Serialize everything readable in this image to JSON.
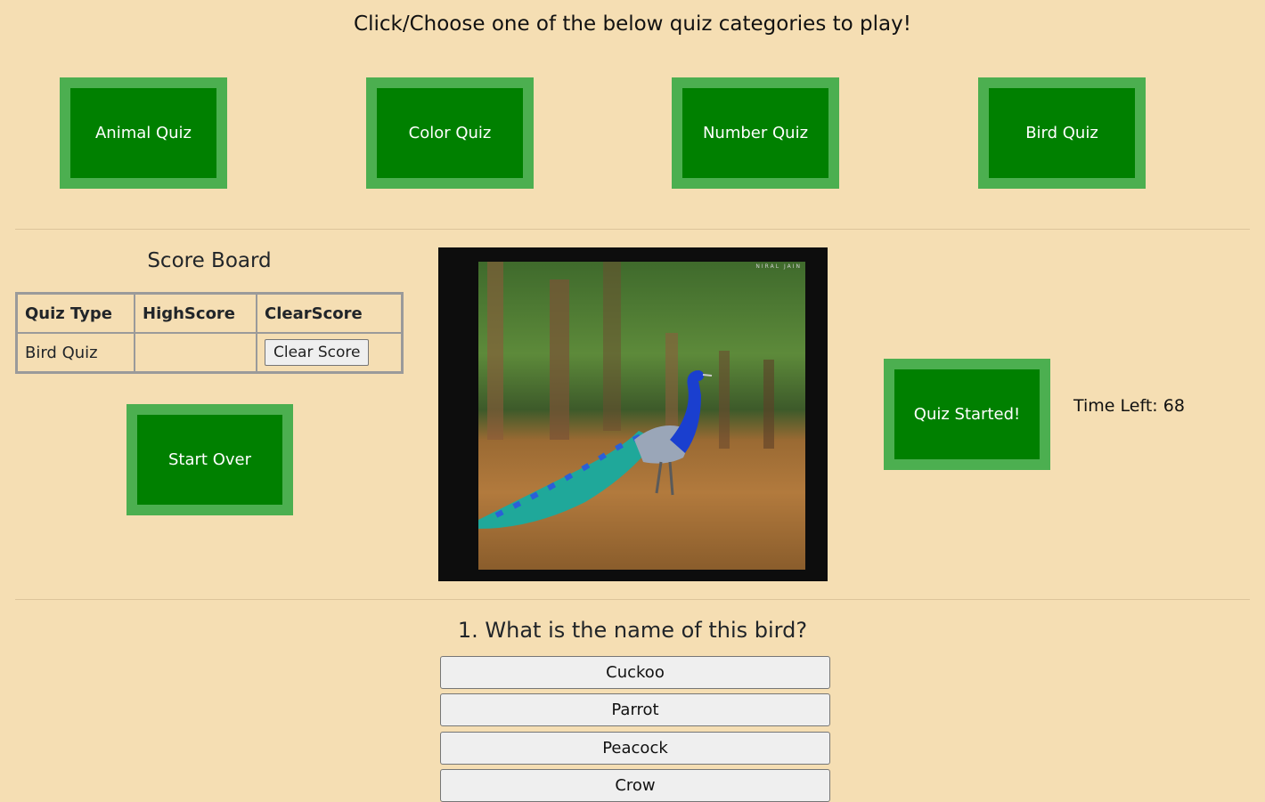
{
  "header": {
    "instruction": "Click/Choose one of the below quiz categories to play!"
  },
  "categories": [
    {
      "label": "Animal Quiz"
    },
    {
      "label": "Color Quiz"
    },
    {
      "label": "Number Quiz"
    },
    {
      "label": "Bird Quiz"
    }
  ],
  "scoreboard": {
    "title": "Score Board",
    "columns": [
      "Quiz Type",
      "HighScore",
      "ClearScore"
    ],
    "rows": [
      {
        "quiz_type": "Bird Quiz",
        "high_score": "",
        "clear_label": "Clear Score"
      }
    ]
  },
  "controls": {
    "start_over_label": "Start Over",
    "quiz_status_label": "Quiz Started!",
    "time_left": "Time Left: 68"
  },
  "image": {
    "alt": "Peacock standing in dry grass in a forest",
    "watermark": "NIRAL JAIN"
  },
  "question": {
    "text": "1. What is the name of this bird?",
    "options": [
      "Cuckoo",
      "Parrot",
      "Peacock",
      "Crow"
    ]
  },
  "colors": {
    "background": "#f5deb3",
    "button_green": "#008000",
    "button_border": "#4caf50"
  }
}
